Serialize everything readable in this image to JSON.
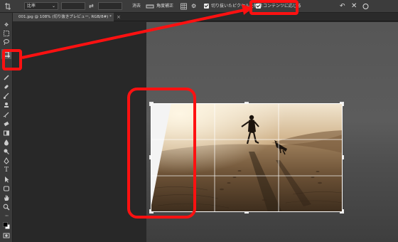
{
  "options_bar": {
    "ratio_label": "比率",
    "clear_button": "消去",
    "straighten_label": "角度補正",
    "delete_cropped_label": "切り抜いたピクセルを削除",
    "content_aware_label": "コンテンツに応じる"
  },
  "document_tab": {
    "title": "001.jpg @ 108% (切り抜きプレビュー, RGB/8#) *",
    "close": "×"
  },
  "colors": {
    "annotation_red": "#ff1111",
    "panel": "#3c3c3c",
    "canvas_bg": "#282828"
  },
  "icons": [
    "crop-icon",
    "swap-icon",
    "straighten-icon",
    "grid-overlay-icon",
    "gear-icon",
    "reset-icon",
    "cancel-icon",
    "commit-icon"
  ]
}
